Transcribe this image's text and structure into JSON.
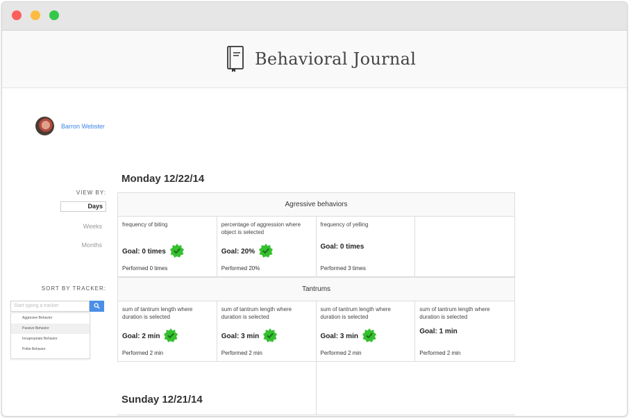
{
  "window": {
    "controls": [
      "close",
      "minimize",
      "zoom"
    ],
    "colors": {
      "close": "#fc605c",
      "minimize": "#fdbc40",
      "zoom": "#34c84a"
    }
  },
  "header": {
    "title": "Behavioral Journal",
    "logo_icon": "book-icon"
  },
  "user": {
    "name": "Barron Webster"
  },
  "view_by": {
    "label": "VIEW BY:",
    "options": [
      "Days",
      "Weeks",
      "Months"
    ],
    "selected": "Days"
  },
  "sort_by": {
    "label": "SORT BY TRACKER:",
    "placeholder": "Start typing a tracker",
    "button_icon": "search-icon",
    "options": [
      "Aggresive Behavior",
      "Passive Behavior",
      "Innapropriate Behavior",
      "Polite Behavior"
    ],
    "highlighted": "Passive Behavior"
  },
  "days": [
    {
      "heading": "Monday 12/22/14",
      "sections": [
        {
          "title": "Agressive behaviors",
          "cells": [
            {
              "metric": "frequency of biting",
              "goal": "Goal: 0 times",
              "met": true,
              "performed": "Performed 0 times"
            },
            {
              "metric": "percentage of aggression where object is selected",
              "goal": "Goal: 20%",
              "met": true,
              "performed": "Performed 20%"
            },
            {
              "metric": "frequency of yelling",
              "goal": "Goal: 0 times",
              "met": false,
              "performed": "Performed 3 times"
            }
          ]
        },
        {
          "title": "Tantrums",
          "cells": [
            {
              "metric": "sum of tantrum length where duration is selected",
              "goal": "Goal: 2 min",
              "met": true,
              "performed": "Performed 2 min"
            },
            {
              "metric": "sum of tantrum length where duration is selected",
              "goal": "Goal: 3 min",
              "met": true,
              "performed": "Performed 2 min"
            },
            {
              "metric": "sum of tantrum length where duration is selected",
              "goal": "Goal: 3 min",
              "met": true,
              "performed": "Performed 2 min"
            },
            {
              "metric": "sum of tantrum length where duration is selected",
              "goal": "Goal: 1 min",
              "met": false,
              "performed": "Performed 2 min"
            }
          ]
        }
      ]
    },
    {
      "heading": "Sunday 12/21/14"
    }
  ],
  "colors": {
    "accent": "#4a8fe7",
    "link": "#3b83e6",
    "badge": "#35c02f"
  }
}
